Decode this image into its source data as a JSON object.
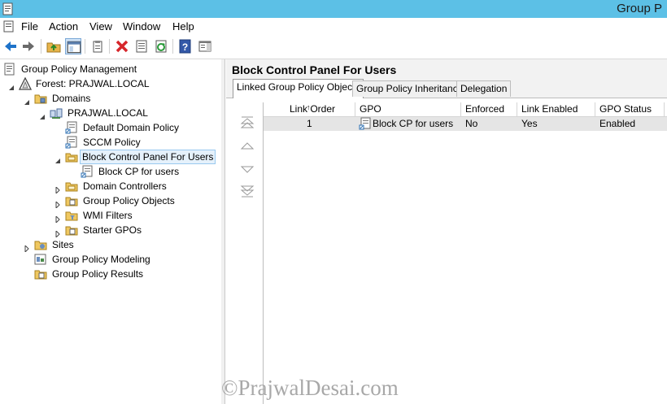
{
  "window": {
    "title": "Group P"
  },
  "menu": [
    "File",
    "Action",
    "View",
    "Window",
    "Help"
  ],
  "toolbar": {
    "icons": [
      "back-arrow-icon",
      "forward-arrow-icon",
      "up-folder-icon",
      "show-hide-console-tree-icon",
      "clipboard-icon",
      "delete-icon",
      "properties-icon",
      "refresh-icon",
      "help-icon",
      "show-hide-action-pane-icon"
    ]
  },
  "tree": {
    "root": "Group Policy Management",
    "forest": "Forest: PRAJWAL.LOCAL",
    "domains": "Domains",
    "domain": "PRAJWAL.LOCAL",
    "default_policy": "Default Domain Policy",
    "sccm_policy": "SCCM Policy",
    "block_cp_users": "Block Control Panel For Users",
    "block_cp_gpo": "Block CP for users",
    "domain_controllers": "Domain Controllers",
    "gpo_container": "Group Policy Objects",
    "wmi_filters": "WMI Filters",
    "starter_gpos": "Starter GPOs",
    "sites": "Sites",
    "modeling": "Group Policy Modeling",
    "results": "Group Policy Results"
  },
  "details": {
    "title": "Block Control Panel For Users",
    "tabs": [
      "Linked Group Policy Objects",
      "Group Policy Inheritance",
      "Delegation"
    ],
    "columns": [
      "Link Order",
      "GPO",
      "Enforced",
      "Link Enabled",
      "GPO Status"
    ],
    "rows": [
      {
        "link_order": "1",
        "gpo": "Block CP for users",
        "enforced": "No",
        "link_enabled": "Yes",
        "gpo_status": "Enabled"
      }
    ]
  },
  "watermark": "©PrajwalDesai.com"
}
